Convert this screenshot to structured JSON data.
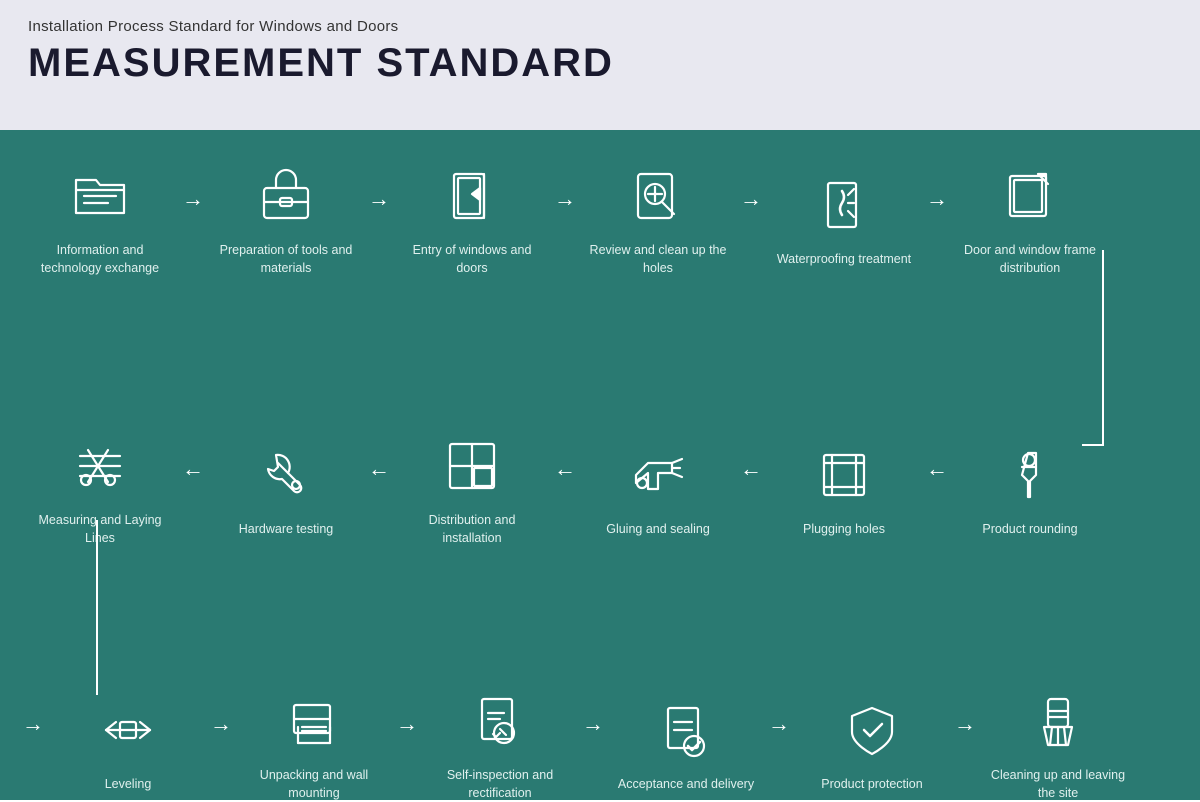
{
  "header": {
    "subtitle": "Installation Process Standard for Windows and Doors",
    "title": "MEASUREMENT STANDARD"
  },
  "colors": {
    "bg_main": "#2a7a72",
    "bg_header": "#e8e8f0",
    "text_header_dark": "#1a1a2e",
    "text_step": "#e0f0ee"
  },
  "row1": [
    {
      "id": "info-exchange",
      "label": "Information and technology exchange",
      "icon": "folder"
    },
    {
      "id": "prep-tools",
      "label": "Preparation of tools and materials",
      "icon": "toolbox"
    },
    {
      "id": "entry-windows",
      "label": "Entry of windows and doors",
      "icon": "door-entry"
    },
    {
      "id": "review-holes",
      "label": "Review and clean up the holes",
      "icon": "magnify"
    },
    {
      "id": "waterproofing",
      "label": "Waterproofing treatment",
      "icon": "waterproof"
    },
    {
      "id": "frame-dist",
      "label": "Door and window frame distribution",
      "icon": "frame-export"
    }
  ],
  "row2": [
    {
      "id": "measuring",
      "label": "Measuring and Laying Lines",
      "icon": "scissors-ruler"
    },
    {
      "id": "hardware",
      "label": "Hardware testing",
      "icon": "wrench"
    },
    {
      "id": "dist-install",
      "label": "Distribution and installation",
      "icon": "grid-square"
    },
    {
      "id": "gluing",
      "label": "Gluing and sealing",
      "icon": "glue-gun"
    },
    {
      "id": "plugging",
      "label": "Plugging holes",
      "icon": "plug-holes"
    },
    {
      "id": "product-round",
      "label": "Product rounding",
      "icon": "pin"
    }
  ],
  "row3": [
    {
      "id": "leveling",
      "label": "Leveling",
      "icon": "level"
    },
    {
      "id": "unpacking",
      "label": "Unpacking and wall mounting",
      "icon": "wall-mount"
    },
    {
      "id": "self-inspect",
      "label": "Self-inspection and rectification",
      "icon": "inspect"
    },
    {
      "id": "acceptance",
      "label": "Acceptance and delivery",
      "icon": "accept"
    },
    {
      "id": "product-protect",
      "label": "Product protection",
      "icon": "shield"
    },
    {
      "id": "cleanup",
      "label": "Cleaning up and leaving the site",
      "icon": "broom"
    }
  ]
}
